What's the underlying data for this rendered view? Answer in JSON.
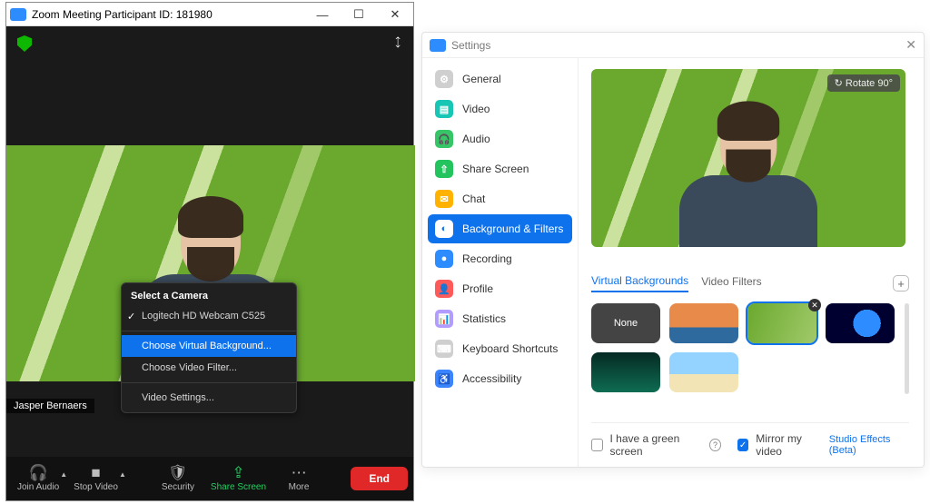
{
  "meeting": {
    "title": "Zoom Meeting Participant ID: 181980",
    "username": "Jasper Bernaers",
    "menu": {
      "header": "Select a Camera",
      "camera": "Logitech HD Webcam C525",
      "choose_vb": "Choose Virtual Background...",
      "choose_vf": "Choose Video Filter...",
      "settings": "Video Settings..."
    },
    "toolbar": {
      "join_audio": "Join Audio",
      "stop_video": "Stop Video",
      "security": "Security",
      "share_screen": "Share Screen",
      "more": "More",
      "end": "End"
    }
  },
  "settings": {
    "title": "Settings",
    "rotate": "Rotate 90°",
    "sidebar": {
      "general": "General",
      "video": "Video",
      "audio": "Audio",
      "share": "Share Screen",
      "chat": "Chat",
      "bg": "Background & Filters",
      "recording": "Recording",
      "profile": "Profile",
      "stats": "Statistics",
      "shortcuts": "Keyboard Shortcuts",
      "access": "Accessibility"
    },
    "tabs": {
      "vb": "Virtual Backgrounds",
      "vf": "Video Filters"
    },
    "thumbs": {
      "none": "None"
    },
    "footer": {
      "green": "I have a green screen",
      "mirror": "Mirror my video",
      "studio": "Studio Effects (Beta)"
    }
  }
}
